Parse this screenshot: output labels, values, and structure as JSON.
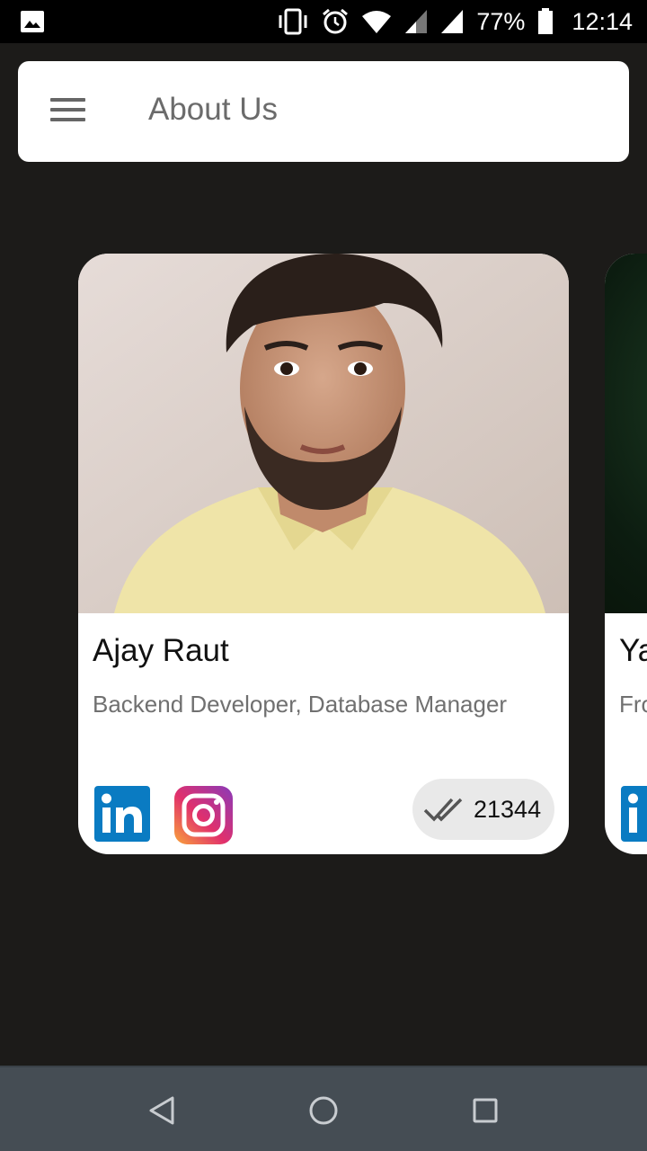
{
  "status_bar": {
    "battery_percent": "77%",
    "time": "12:14",
    "icons": [
      "gallery-icon",
      "vibrate-icon",
      "alarm-icon",
      "wifi-icon",
      "signal-icon",
      "signal-icon",
      "battery-icon"
    ]
  },
  "toolbar": {
    "title": "About Us",
    "menu_icon": "hamburger-menu-icon"
  },
  "cards": [
    {
      "name": "Ajay Raut",
      "role": "Backend Developer, Database Manager",
      "links": [
        "linkedin-icon",
        "instagram-icon"
      ],
      "count": "21344",
      "count_icon": "double-check-icon"
    },
    {
      "name": "Ya",
      "role": "Fro",
      "links": [
        "linkedin-icon"
      ]
    }
  ],
  "nav_bar": {
    "buttons": [
      "back-icon",
      "home-icon",
      "recents-icon"
    ]
  },
  "colors": {
    "background": "#1c1b19",
    "linkedin": "#0a7bc2",
    "nav_bar": "#454d54"
  }
}
